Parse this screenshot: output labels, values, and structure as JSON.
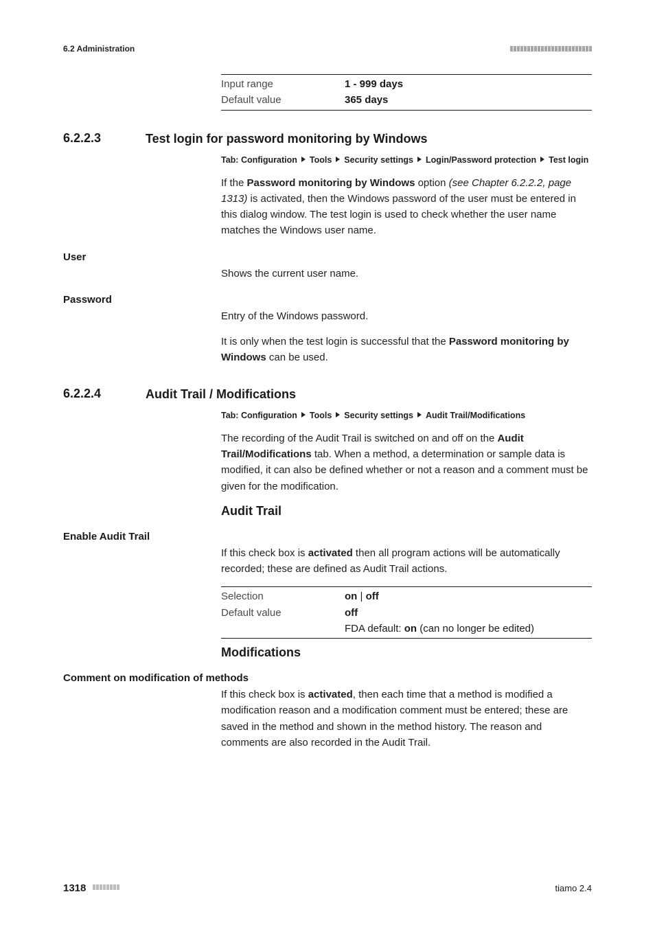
{
  "header": {
    "section_label": "6.2 Administration"
  },
  "top_props": {
    "input_range_key": "Input range",
    "input_range_val": "1 - 999 days",
    "default_value_key": "Default value",
    "default_value_val": "365 days"
  },
  "sec_6_2_2_3": {
    "num": "6.2.2.3",
    "title": "Test login for password monitoring by Windows",
    "tab_prefix": "Tab: ",
    "tab_parts": [
      "Configuration",
      "Tools",
      "Security settings",
      "Login/Password protection",
      "Test login"
    ],
    "p1_a": "If the ",
    "p1_b": "Password monitoring by Windows",
    "p1_c": " option ",
    "p1_ref": "(see Chapter 6.2.2.2, page 1313)",
    "p1_d": " is activated, then the Windows password of the user must be entered in this dialog window. The test login is used to check whether the user name matches the Windows user name."
  },
  "user": {
    "label": "User",
    "desc": "Shows the current user name."
  },
  "password": {
    "label": "Password",
    "desc1": "Entry of the Windows password.",
    "desc2_a": "It is only when the test login is successful that the ",
    "desc2_b": "Password monitoring by Windows",
    "desc2_c": " can be used."
  },
  "sec_6_2_2_4": {
    "num": "6.2.2.4",
    "title": "Audit Trail / Modifications",
    "tab_prefix": "Tab: ",
    "tab_parts": [
      "Configuration",
      "Tools",
      "Security settings",
      "Audit Trail/Modifications"
    ],
    "p1_a": "The recording of the Audit Trail is switched on and off on the ",
    "p1_b": "Audit Trail/Modifications",
    "p1_c": " tab. When a method, a determination or sample data is modified, it can also be defined whether or not a reason and a comment must be given for the modification."
  },
  "audit_trail": {
    "heading": "Audit Trail",
    "enable_label": "Enable Audit Trail",
    "enable_desc_a": "If this check box is ",
    "enable_desc_b": "activated",
    "enable_desc_c": " then all program actions will be automatically recorded; these are defined as Audit Trail actions.",
    "selection_key": "Selection",
    "selection_on": "on",
    "selection_pipe": " | ",
    "selection_off": "off",
    "default_value_key": "Default value",
    "default_value_val": "off",
    "fda_a": "FDA default: ",
    "fda_b": "on",
    "fda_c": " (can no longer be edited)"
  },
  "modifications": {
    "heading": "Modifications",
    "comment_label": "Comment on modification of methods",
    "desc_a": "If this check box is ",
    "desc_b": "activated",
    "desc_c": ", then each time that a method is modified a modification reason and a modification comment must be entered; these are saved in the method and shown in the method history. The reason and comments are also recorded in the Audit Trail."
  },
  "footer": {
    "page": "1318",
    "product": "tiamo 2.4"
  }
}
